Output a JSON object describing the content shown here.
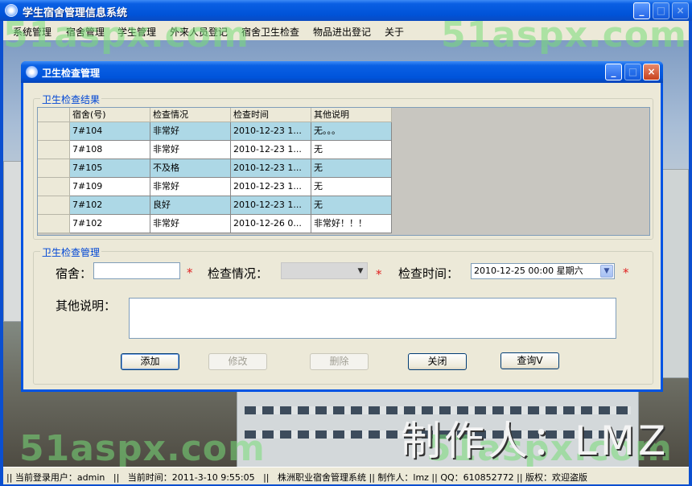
{
  "app": {
    "title": "学生宿舍管理信息系统",
    "menu": [
      "系统管理",
      "宿舍管理",
      "学生管理",
      "外来人员登记",
      "宿舍卫生检查",
      "物品进出登记",
      "关于"
    ]
  },
  "dialog": {
    "title": "卫生检查管理",
    "results_group": "卫生检查结果",
    "grid": {
      "columns": [
        "宿舍(号)",
        "检查情况",
        "检查时间",
        "其他说明"
      ],
      "rows": [
        [
          "7#104",
          "非常好",
          "2010-12-23 1...",
          "无。。。"
        ],
        [
          "7#108",
          "非常好",
          "2010-12-23 1...",
          "无"
        ],
        [
          "7#105",
          "不及格",
          "2010-12-23 1...",
          "无"
        ],
        [
          "7#109",
          "非常好",
          "2010-12-23 1...",
          "无"
        ],
        [
          "7#102",
          "良好",
          "2010-12-23 1...",
          "无"
        ],
        [
          "7#102",
          "非常好",
          "2010-12-26 0...",
          "非常好！！！"
        ]
      ]
    },
    "manage_group": "卫生检查管理",
    "form": {
      "dorm_label": "宿舍：",
      "dorm_value": "",
      "condition_label": "检查情况：",
      "condition_value": "",
      "time_label": "检查时间：",
      "time_value": "2010-12-25 00:00 星期六",
      "notes_label": "其他说明：",
      "notes_value": "",
      "required_mark": "*"
    },
    "buttons": {
      "add": "添加",
      "edit": "修改",
      "delete": "删除",
      "close": "关闭",
      "query": "查询V"
    }
  },
  "watermark": "51aspx.com",
  "maker_sign": "制作人：LMZ",
  "statusbar": {
    "text": "|| 当前登录用户：admin   ||   当前时间：2011-3-10 9:55:05   ||   株洲职业宿舍管理系统 || 制作人：lmz || QQ：610852772 || 版权：欢迎盗版"
  },
  "colors": {
    "row_alt": "#add8e6",
    "row_normal": "#ffffff",
    "group_title": "#0046d5",
    "required": "#e02020"
  }
}
